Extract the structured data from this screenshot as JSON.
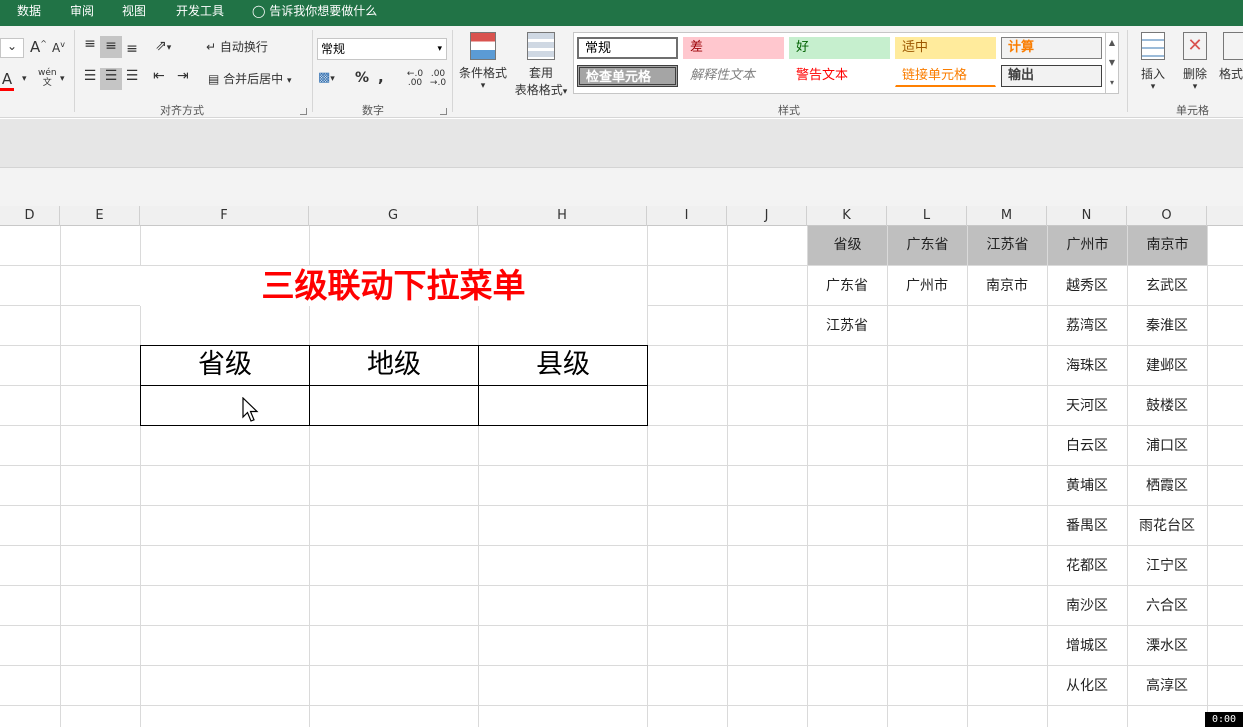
{
  "menu": {
    "items": [
      "数据",
      "审阅",
      "视图",
      "开发工具"
    ],
    "tell_me": "告诉我你想要做什么"
  },
  "ribbon": {
    "alignment": {
      "wrap_text": "自动换行",
      "merge_center": "合并后居中",
      "group_label": "对齐方式"
    },
    "number": {
      "format_value": "常规",
      "percent": "%",
      "comma": ",",
      "inc_decimal": "←.0 .00",
      "dec_decimal": ".00 →.0",
      "group_label": "数字"
    },
    "styles": {
      "conditional_format": "条件格式",
      "format_as_table_1": "套用",
      "format_as_table_2": "表格格式",
      "cells": [
        {
          "label": "常规",
          "bg": "#ffffff",
          "color": "#000000"
        },
        {
          "label": "差",
          "bg": "#ffc7ce",
          "color": "#9c0006"
        },
        {
          "label": "好",
          "bg": "#c6efce",
          "color": "#006100"
        },
        {
          "label": "适中",
          "bg": "#ffeb9c",
          "color": "#9c5700"
        },
        {
          "label": "计算",
          "bg": "#f2f2f2",
          "color": "#fa7d00"
        },
        {
          "label": "检查单元格",
          "bg": "#a5a5a5",
          "color": "#ffffff"
        },
        {
          "label": "解释性文本",
          "bg": "#ffffff",
          "color": "#7f7f7f"
        },
        {
          "label": "警告文本",
          "bg": "#ffffff",
          "color": "#ff0000"
        },
        {
          "label": "链接单元格",
          "bg": "#ffffff",
          "color": "#fa7d00"
        },
        {
          "label": "输出",
          "bg": "#f2f2f2",
          "color": "#3f3f3f"
        }
      ],
      "group_label": "样式"
    },
    "cells_group": {
      "insert": "插入",
      "delete": "删除",
      "format": "格式",
      "group_label": "单元格"
    },
    "font": {
      "grow": "A",
      "shrink": "A",
      "font_color": "A",
      "phonetic_top": "wén",
      "phonetic_bottom": "文"
    }
  },
  "sheet": {
    "columns": [
      "D",
      "E",
      "F",
      "G",
      "H",
      "I",
      "J",
      "K",
      "L",
      "M",
      "N",
      "O"
    ],
    "title": "三级联动下拉菜单",
    "selector_headers": [
      "省级",
      "地级",
      "县级"
    ],
    "lookup_headers": [
      "省级",
      "广东省",
      "江苏省",
      "广州市",
      "南京市"
    ],
    "lookup": {
      "provinces": [
        "广东省",
        "江苏省"
      ],
      "guangdong": [
        "广州市"
      ],
      "jiangsu": [
        "南京市"
      ],
      "guangzhou": [
        "越秀区",
        "荔湾区",
        "海珠区",
        "天河区",
        "白云区",
        "黄埔区",
        "番禺区",
        "花都区",
        "南沙区",
        "增城区",
        "从化区"
      ],
      "nanjing": [
        "玄武区",
        "秦淮区",
        "建邺区",
        "鼓楼区",
        "浦口区",
        "栖霞区",
        "雨花台区",
        "江宁区",
        "六合区",
        "溧水区",
        "高淳区"
      ]
    },
    "timer": "0:00"
  }
}
